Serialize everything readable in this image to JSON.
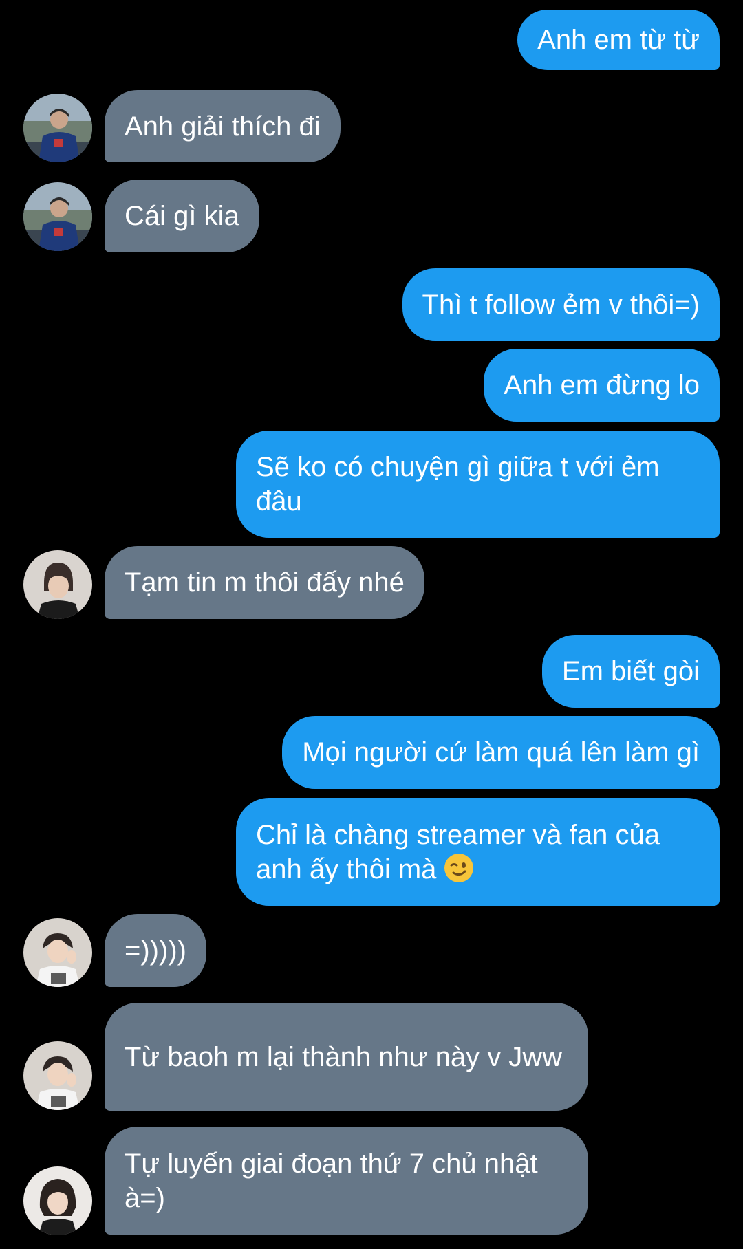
{
  "conversation": {
    "messages": [
      {
        "side": "out",
        "text": "Anh em từ từ"
      },
      {
        "side": "in",
        "avatar": "avatar-1",
        "text": "Anh giải thích đi"
      },
      {
        "side": "in",
        "avatar": "avatar-1",
        "text": "Cái gì kia"
      },
      {
        "side": "out",
        "text": "Thì t follow ẻm v thôi=)"
      },
      {
        "side": "out",
        "text": "Anh em đừng lo"
      },
      {
        "side": "out",
        "text": "Sẽ ko có chuyện gì giữa t với ẻm đâu"
      },
      {
        "side": "in",
        "avatar": "avatar-2",
        "text": "Tạm tin m thôi đấy nhé"
      },
      {
        "side": "out",
        "text": "Em biết gòi"
      },
      {
        "side": "out",
        "text": "Mọi người cứ làm quá lên làm gì"
      },
      {
        "side": "out",
        "text": "Chỉ là chàng streamer và fan của anh ấy thôi mà",
        "emoji": "winking-face-emoji"
      },
      {
        "side": "in",
        "avatar": "avatar-3",
        "text": "=)))))"
      },
      {
        "side": "in",
        "avatar": "avatar-3",
        "text": "Từ baoh m lại thành như này v Jww"
      },
      {
        "side": "in",
        "avatar": "avatar-4",
        "text": "Tự luyến giai đoạn thứ 7 chủ nhật à=)"
      }
    ]
  },
  "colors": {
    "background": "#000000",
    "outgoing_bubble": "#1d9bf0",
    "incoming_bubble": "#667788",
    "text": "#ffffff"
  }
}
